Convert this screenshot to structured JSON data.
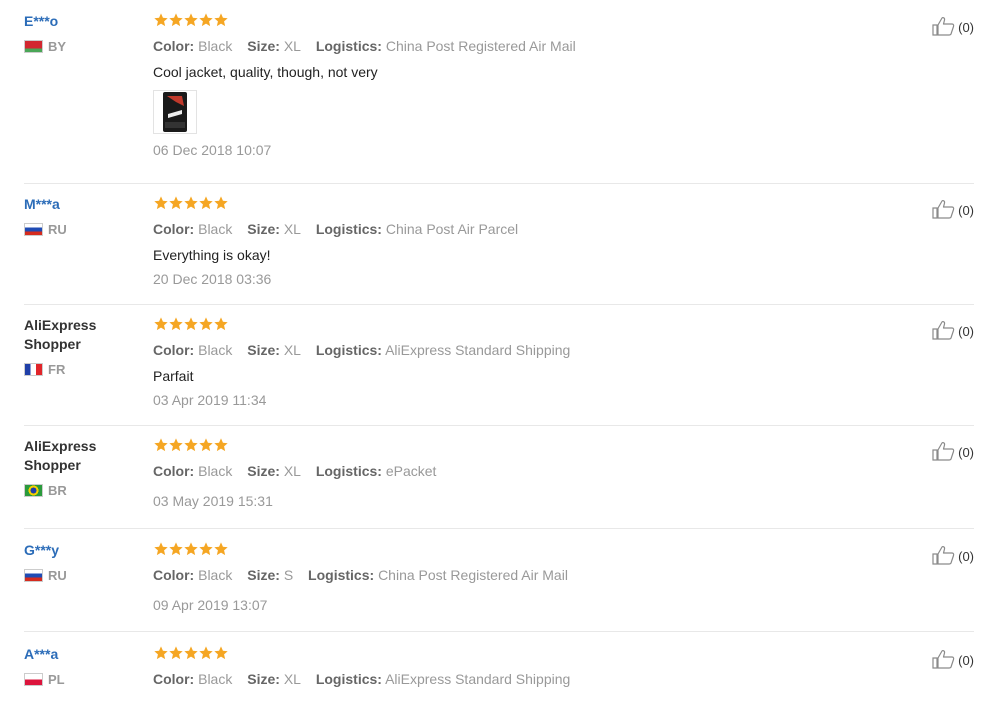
{
  "colors": {
    "star": "#f5a623",
    "username_link": "#2b6cb8"
  },
  "reviews": [
    {
      "user": "E***o",
      "country": "BY",
      "flag": "by",
      "color": "Black",
      "size": "XL",
      "logistics": "China Post Registered Air Mail",
      "text": "Cool jacket, quality, though, not very",
      "has_photo": true,
      "date": "06 Dec 2018 10:07",
      "helpful": "(0)",
      "rating": 5
    },
    {
      "user": "M***a",
      "country": "RU",
      "flag": "ru",
      "color": "Black",
      "size": "XL",
      "logistics": "China Post Air Parcel",
      "text": "Everything is okay!",
      "date": "20 Dec 2018 03:36",
      "helpful": "(0)",
      "rating": 5
    },
    {
      "user": "AliExpress Shopper",
      "country": "FR",
      "flag": "fr",
      "color": "Black",
      "size": "XL",
      "logistics": "AliExpress Standard Shipping",
      "text": "Parfait",
      "date": "03 Apr 2019 11:34",
      "helpful": "(0)",
      "rating": 5
    },
    {
      "user": "AliExpress Shopper",
      "country": "BR",
      "flag": "br",
      "color": "Black",
      "size": "XL",
      "logistics": "ePacket",
      "text": "",
      "date": "03 May 2019 15:31",
      "helpful": "(0)",
      "rating": 5
    },
    {
      "user": "G***y",
      "country": "RU",
      "flag": "ru",
      "color": "Black",
      "size": "S",
      "logistics": "China Post Registered Air Mail",
      "text": "",
      "date": "09 Apr 2019 13:07",
      "helpful": "(0)",
      "rating": 5
    },
    {
      "user": "A***a",
      "country": "PL",
      "flag": "pl",
      "color": "Black",
      "size": "XL",
      "logistics": "AliExpress Standard Shipping",
      "text": "",
      "date": "",
      "helpful": "(0)",
      "rating": 5
    }
  ],
  "labels": {
    "color": "Color:",
    "size": "Size:",
    "logistics": "Logistics:"
  },
  "icons": {
    "star": "star-icon",
    "thumbs_up": "thumbs-up-icon"
  }
}
